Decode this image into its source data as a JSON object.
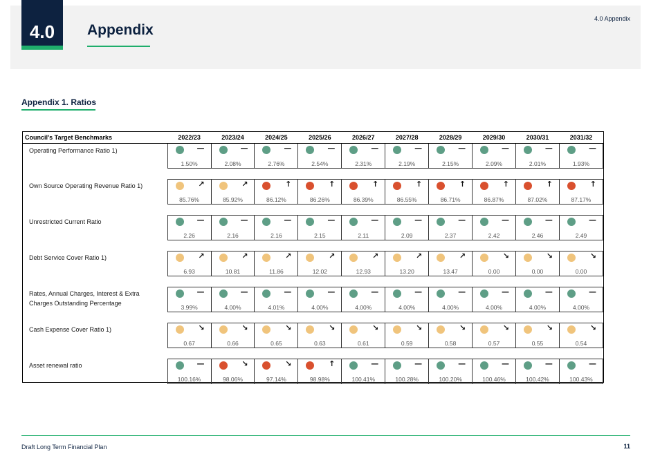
{
  "header": {
    "section_number": "4.0",
    "title": "Appendix",
    "corner_label": "4.0 Appendix"
  },
  "subheading": "Appendix 1. Ratios",
  "colors": {
    "green": "#5e9e86",
    "amber": "#f0c47c",
    "red": "#d9502e",
    "navy": "#0d2240",
    "accent": "#1fae6c"
  },
  "table": {
    "label_header": "Council's Target Benchmarks",
    "years": [
      "2022/23",
      "2023/24",
      "2024/25",
      "2025/26",
      "2026/27",
      "2027/28",
      "2028/29",
      "2029/30",
      "2030/31",
      "2031/32"
    ],
    "rows": [
      {
        "label": "Operating Performance Ratio 1)",
        "status": [
          "green",
          "green",
          "green",
          "green",
          "green",
          "green",
          "green",
          "green",
          "green",
          "green"
        ],
        "trend": [
          "—",
          "—",
          "—",
          "—",
          "—",
          "—",
          "—",
          "—",
          "—",
          "—"
        ],
        "values": [
          "1.50%",
          "2.08%",
          "2.76%",
          "2.54%",
          "2.31%",
          "2.19%",
          "2.15%",
          "2.09%",
          "2.01%",
          "1.93%"
        ]
      },
      {
        "label": "Own Source Operating Revenue Ratio 1)",
        "status": [
          "amber",
          "amber",
          "red",
          "red",
          "red",
          "red",
          "red",
          "red",
          "red",
          "red"
        ],
        "trend": [
          "↗",
          "↗",
          "↑",
          "↑",
          "↑",
          "↑",
          "↑",
          "↑",
          "↑",
          "↑"
        ],
        "values": [
          "85.76%",
          "85.92%",
          "86.12%",
          "86.26%",
          "86.39%",
          "86.55%",
          "86.71%",
          "86.87%",
          "87.02%",
          "87.17%"
        ]
      },
      {
        "label": "Unrestricted Current Ratio",
        "status": [
          "green",
          "green",
          "green",
          "green",
          "green",
          "green",
          "green",
          "green",
          "green",
          "green"
        ],
        "trend": [
          "—",
          "—",
          "—",
          "—",
          "—",
          "—",
          "—",
          "—",
          "—",
          "—"
        ],
        "values": [
          "2.26",
          "2.16",
          "2.16",
          "2.15",
          "2.11",
          "2.09",
          "2.37",
          "2.42",
          "2.46",
          "2.49"
        ]
      },
      {
        "label": "Debt Service Cover Ratio 1)",
        "status": [
          "amber",
          "amber",
          "amber",
          "amber",
          "amber",
          "amber",
          "amber",
          "amber",
          "amber",
          "amber"
        ],
        "trend": [
          "↗",
          "↗",
          "↗",
          "↗",
          "↗",
          "↗",
          "↗",
          "↘",
          "↘",
          "↘"
        ],
        "values": [
          "6.93",
          "10.81",
          "11.86",
          "12.02",
          "12.93",
          "13.20",
          "13.47",
          "0.00",
          "0.00",
          "0.00"
        ]
      },
      {
        "label": "Rates, Annual Charges, Interest & Extra Charges Outstanding Percentage",
        "status": [
          "green",
          "green",
          "green",
          "green",
          "green",
          "green",
          "green",
          "green",
          "green",
          "green"
        ],
        "trend": [
          "—",
          "—",
          "—",
          "—",
          "—",
          "—",
          "—",
          "—",
          "—",
          "—"
        ],
        "values": [
          "3.99%",
          "4.00%",
          "4.01%",
          "4.00%",
          "4.00%",
          "4.00%",
          "4.00%",
          "4.00%",
          "4.00%",
          "4.00%"
        ]
      },
      {
        "label": "Cash Expense Cover Ratio 1)",
        "status": [
          "amber",
          "amber",
          "amber",
          "amber",
          "amber",
          "amber",
          "amber",
          "amber",
          "amber",
          "amber"
        ],
        "trend": [
          "↘",
          "↘",
          "↘",
          "↘",
          "↘",
          "↘",
          "↘",
          "↘",
          "↘",
          "↘"
        ],
        "values": [
          "0.67",
          "0.66",
          "0.65",
          "0.63",
          "0.61",
          "0.59",
          "0.58",
          "0.57",
          "0.55",
          "0.54"
        ]
      },
      {
        "label": "Asset renewal ratio",
        "status": [
          "green",
          "red",
          "red",
          "red",
          "green",
          "green",
          "green",
          "green",
          "green",
          "green"
        ],
        "trend": [
          "—",
          "↘",
          "↘",
          "↑",
          "—",
          "—",
          "—",
          "—",
          "—",
          "—"
        ],
        "values": [
          "100.16%",
          "98.06%",
          "97.14%",
          "98.98%",
          "100.41%",
          "100.28%",
          "100.20%",
          "100.46%",
          "100.42%",
          "100.43%"
        ]
      }
    ]
  },
  "footer": {
    "left": "Draft Long Term Financial Plan",
    "page_number": "11"
  }
}
